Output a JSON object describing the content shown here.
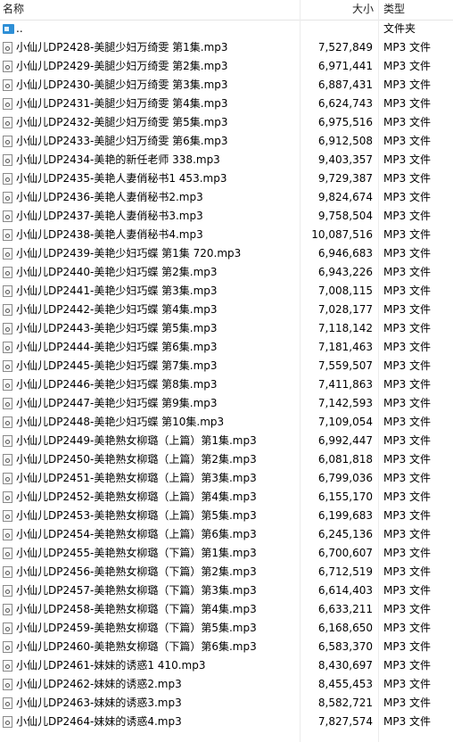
{
  "columns": {
    "name": "名称",
    "size": "大小",
    "type": "类型",
    "sort_indicator": "^"
  },
  "up_row": {
    "name": "..",
    "type": "文件夹",
    "icon": "folder-up-icon"
  },
  "file_icon": "audio-file-icon",
  "files": [
    {
      "name": "小仙儿DP2428-美腿少妇万绮雯 第1集.mp3",
      "size": "7,527,849",
      "type": "MP3 文件"
    },
    {
      "name": "小仙儿DP2429-美腿少妇万绮雯 第2集.mp3",
      "size": "6,971,441",
      "type": "MP3 文件"
    },
    {
      "name": "小仙儿DP2430-美腿少妇万绮雯 第3集.mp3",
      "size": "6,887,431",
      "type": "MP3 文件"
    },
    {
      "name": "小仙儿DP2431-美腿少妇万绮雯 第4集.mp3",
      "size": "6,624,743",
      "type": "MP3 文件"
    },
    {
      "name": "小仙儿DP2432-美腿少妇万绮雯 第5集.mp3",
      "size": "6,975,516",
      "type": "MP3 文件"
    },
    {
      "name": "小仙儿DP2433-美腿少妇万绮雯 第6集.mp3",
      "size": "6,912,508",
      "type": "MP3 文件"
    },
    {
      "name": "小仙儿DP2434-美艳的新任老师 338.mp3",
      "size": "9,403,357",
      "type": "MP3 文件"
    },
    {
      "name": "小仙儿DP2435-美艳人妻俏秘书1 453.mp3",
      "size": "9,729,387",
      "type": "MP3 文件"
    },
    {
      "name": "小仙儿DP2436-美艳人妻俏秘书2.mp3",
      "size": "9,824,674",
      "type": "MP3 文件"
    },
    {
      "name": "小仙儿DP2437-美艳人妻俏秘书3.mp3",
      "size": "9,758,504",
      "type": "MP3 文件"
    },
    {
      "name": "小仙儿DP2438-美艳人妻俏秘书4.mp3",
      "size": "10,087,516",
      "type": "MP3 文件"
    },
    {
      "name": "小仙儿DP2439-美艳少妇巧蝶 第1集 720.mp3",
      "size": "6,946,683",
      "type": "MP3 文件"
    },
    {
      "name": "小仙儿DP2440-美艳少妇巧蝶 第2集.mp3",
      "size": "6,943,226",
      "type": "MP3 文件"
    },
    {
      "name": "小仙儿DP2441-美艳少妇巧蝶 第3集.mp3",
      "size": "7,008,115",
      "type": "MP3 文件"
    },
    {
      "name": "小仙儿DP2442-美艳少妇巧蝶 第4集.mp3",
      "size": "7,028,177",
      "type": "MP3 文件"
    },
    {
      "name": "小仙儿DP2443-美艳少妇巧蝶 第5集.mp3",
      "size": "7,118,142",
      "type": "MP3 文件"
    },
    {
      "name": "小仙儿DP2444-美艳少妇巧蝶 第6集.mp3",
      "size": "7,181,463",
      "type": "MP3 文件"
    },
    {
      "name": "小仙儿DP2445-美艳少妇巧蝶 第7集.mp3",
      "size": "7,559,507",
      "type": "MP3 文件"
    },
    {
      "name": "小仙儿DP2446-美艳少妇巧蝶 第8集.mp3",
      "size": "7,411,863",
      "type": "MP3 文件"
    },
    {
      "name": "小仙儿DP2447-美艳少妇巧蝶 第9集.mp3",
      "size": "7,142,593",
      "type": "MP3 文件"
    },
    {
      "name": "小仙儿DP2448-美艳少妇巧蝶 第10集.mp3",
      "size": "7,109,054",
      "type": "MP3 文件"
    },
    {
      "name": "小仙儿DP2449-美艳熟女柳璐（上篇）第1集.mp3",
      "size": "6,992,447",
      "type": "MP3 文件"
    },
    {
      "name": "小仙儿DP2450-美艳熟女柳璐（上篇）第2集.mp3",
      "size": "6,081,818",
      "type": "MP3 文件"
    },
    {
      "name": "小仙儿DP2451-美艳熟女柳璐（上篇）第3集.mp3",
      "size": "6,799,036",
      "type": "MP3 文件"
    },
    {
      "name": "小仙儿DP2452-美艳熟女柳璐（上篇）第4集.mp3",
      "size": "6,155,170",
      "type": "MP3 文件"
    },
    {
      "name": "小仙儿DP2453-美艳熟女柳璐（上篇）第5集.mp3",
      "size": "6,199,683",
      "type": "MP3 文件"
    },
    {
      "name": "小仙儿DP2454-美艳熟女柳璐（上篇）第6集.mp3",
      "size": "6,245,136",
      "type": "MP3 文件"
    },
    {
      "name": "小仙儿DP2455-美艳熟女柳璐（下篇）第1集.mp3",
      "size": "6,700,607",
      "type": "MP3 文件"
    },
    {
      "name": "小仙儿DP2456-美艳熟女柳璐（下篇）第2集.mp3",
      "size": "6,712,519",
      "type": "MP3 文件"
    },
    {
      "name": "小仙儿DP2457-美艳熟女柳璐（下篇）第3集.mp3",
      "size": "6,614,403",
      "type": "MP3 文件"
    },
    {
      "name": "小仙儿DP2458-美艳熟女柳璐（下篇）第4集.mp3",
      "size": "6,633,211",
      "type": "MP3 文件"
    },
    {
      "name": "小仙儿DP2459-美艳熟女柳璐（下篇）第5集.mp3",
      "size": "6,168,650",
      "type": "MP3 文件"
    },
    {
      "name": "小仙儿DP2460-美艳熟女柳璐（下篇）第6集.mp3",
      "size": "6,583,370",
      "type": "MP3 文件"
    },
    {
      "name": "小仙儿DP2461-妹妹的诱惑1 410.mp3",
      "size": "8,430,697",
      "type": "MP3 文件"
    },
    {
      "name": "小仙儿DP2462-妹妹的诱惑2.mp3",
      "size": "8,455,453",
      "type": "MP3 文件"
    },
    {
      "name": "小仙儿DP2463-妹妹的诱惑3.mp3",
      "size": "8,582,721",
      "type": "MP3 文件"
    },
    {
      "name": "小仙儿DP2464-妹妹的诱惑4.mp3",
      "size": "7,827,574",
      "type": "MP3 文件"
    }
  ]
}
